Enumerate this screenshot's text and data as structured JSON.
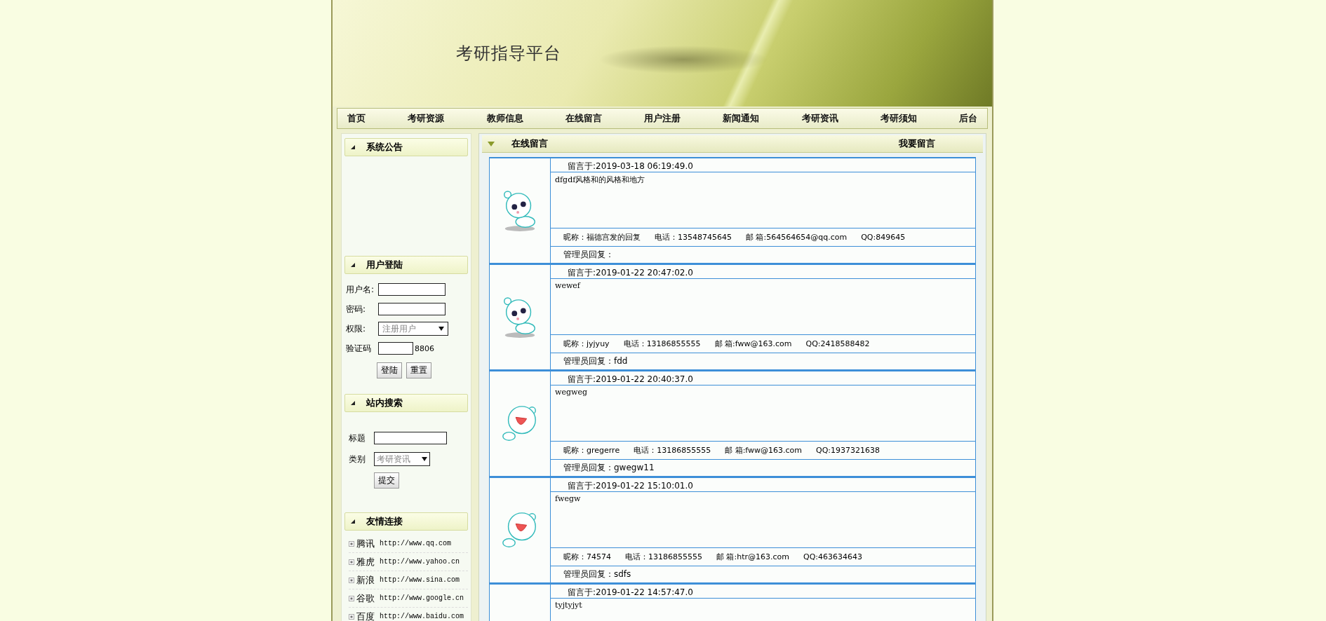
{
  "banner": {
    "title": "考研指导平台"
  },
  "nav": [
    "首页",
    "考研资源",
    "教师信息",
    "在线留言",
    "用户注册",
    "新闻通知",
    "考研资讯",
    "考研须知",
    "后台"
  ],
  "sidebar": {
    "notice": {
      "title": "系统公告"
    },
    "login": {
      "title": "用户登陆",
      "fields": [
        {
          "label": "用户名:",
          "kind": "text"
        },
        {
          "label": "密码:",
          "kind": "password"
        },
        {
          "label": "权限:",
          "kind": "select",
          "value": "注册用户"
        },
        {
          "label": "验证码",
          "kind": "captcha",
          "captcha": "8806"
        }
      ],
      "buttons": [
        "登陆",
        "重置"
      ]
    },
    "search": {
      "title": "站内搜索",
      "fields": [
        {
          "label": "标题",
          "kind": "text"
        },
        {
          "label": "类别",
          "kind": "select",
          "value": "考研资讯"
        }
      ],
      "button": "提交"
    },
    "links": {
      "title": "友情连接",
      "items": [
        {
          "name": "腾讯",
          "url": "http://www.qq.com"
        },
        {
          "name": "雅虎",
          "url": "http://www.yahoo.cn"
        },
        {
          "name": "新浪",
          "url": "http://www.sina.com"
        },
        {
          "name": "谷歌",
          "url": "http://www.google.cn"
        },
        {
          "name": "百度",
          "url": "http://www.baidu.com"
        }
      ]
    }
  },
  "main": {
    "title": "在线留言",
    "action": "我要留言",
    "messages": [
      {
        "kind": "sad",
        "time": "留言于:2019-03-18 06:19:49.0",
        "content": "dfgdf风格和的风格和地方",
        "nickname": "昵称：福德宫发的回复",
        "phone": "电话：13548745645",
        "email": "邮 箱:564564654@qq.com",
        "qq": "QQ:849645",
        "reply": "管理员回复："
      },
      {
        "kind": "sad",
        "time": "留言于:2019-01-22 20:47:02.0",
        "content": "wewef",
        "nickname": "昵称：jyjyuy",
        "phone": "电话：13186855555",
        "email": "邮 箱:fww@163.com",
        "qq": "QQ:2418588482",
        "reply": "管理员回复：fdd"
      },
      {
        "kind": "laughing",
        "time": "留言于:2019-01-22 20:40:37.0",
        "content": "wegweg",
        "nickname": "昵称：gregerre",
        "phone": "电话：13186855555",
        "email": "邮 箱:fww@163.com",
        "qq": "QQ:1937321638",
        "reply": "管理员回复：gwegw11"
      },
      {
        "kind": "laughing",
        "time": "留言于:2019-01-22 15:10:01.0",
        "content": "fwegw",
        "nickname": "昵称：74574",
        "phone": "电话：13186855555",
        "email": "邮 箱:htr@163.com",
        "qq": "QQ:463634643",
        "reply": "管理员回复：sdfs"
      },
      {
        "time": "留言于:2019-01-22 14:57:47.0",
        "content": "tyjtyjyt"
      }
    ]
  }
}
